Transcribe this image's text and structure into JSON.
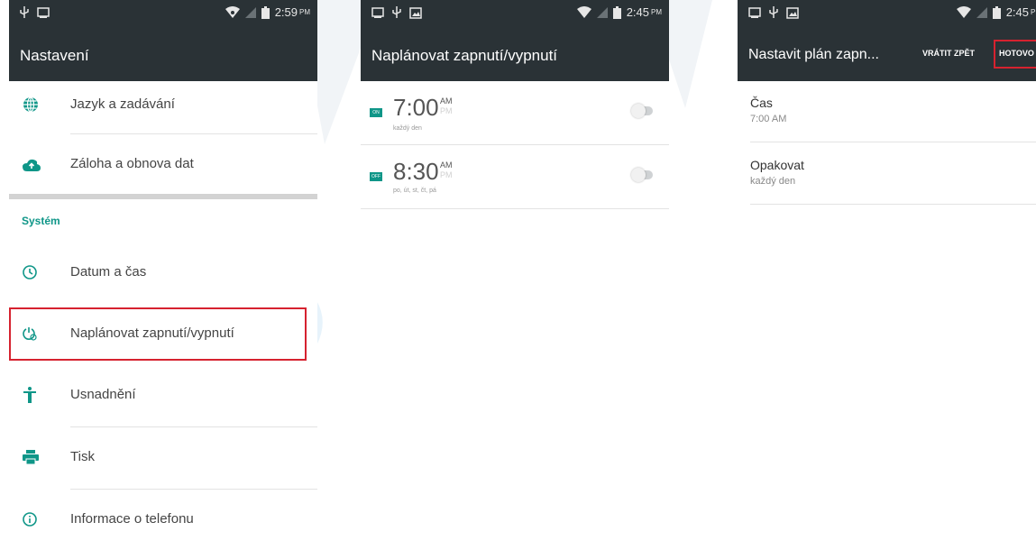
{
  "colors": {
    "bar": "#2a3236",
    "accent": "#0f9688",
    "highlight": "#d6222f"
  },
  "panel1": {
    "status_time": "2:59",
    "status_ampm": "PM",
    "title": "Nastavení",
    "items_top": [
      {
        "icon": "globe-icon",
        "label": "Jazyk a zadávání"
      },
      {
        "icon": "cloud-upload-icon",
        "label": "Záloha a obnova dat"
      }
    ],
    "section_header": "Systém",
    "items_system": [
      {
        "icon": "clock-icon",
        "label": "Datum a čas"
      },
      {
        "icon": "power-schedule-icon",
        "label": "Naplánovat zapnutí/vypnutí",
        "highlighted": true
      },
      {
        "icon": "accessibility-icon",
        "label": "Usnadnění"
      },
      {
        "icon": "printer-icon",
        "label": "Tisk"
      },
      {
        "icon": "info-icon",
        "label": "Informace o telefonu"
      }
    ]
  },
  "panel2": {
    "status_time": "2:45",
    "status_ampm": "PM",
    "title": "Naplánovat zapnutí/vypnutí",
    "schedules": [
      {
        "badge": "ON",
        "time": "7:00",
        "am": "AM",
        "pm": "PM",
        "repeat": "každý den",
        "enabled": false
      },
      {
        "badge": "OFF",
        "time": "8:30",
        "am": "AM",
        "pm": "PM",
        "repeat": "po, út, st, čt, pá",
        "enabled": false
      }
    ]
  },
  "panel3": {
    "status_time": "2:45",
    "status_ampm": "PM",
    "title": "Nastavit plán zapn...",
    "undo_label": "VRÁTIT ZPĚT",
    "done_label": "HOTOVO",
    "rows": [
      {
        "label": "Čas",
        "value": "7:00 AM"
      },
      {
        "label": "Opakovat",
        "value": "každý den"
      }
    ]
  }
}
